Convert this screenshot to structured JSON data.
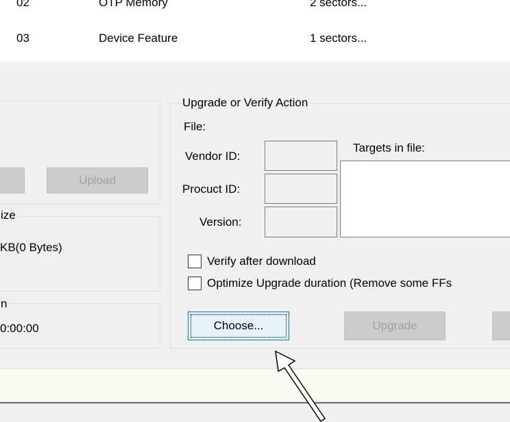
{
  "list": {
    "rows": [
      {
        "index": "02",
        "name": "OTP Memory",
        "size": "2 sectors..."
      },
      {
        "index": "03",
        "name": "Device Feature",
        "size": "1 sectors..."
      }
    ]
  },
  "left": {
    "upload_label": "Upload",
    "size_group_label": "ize",
    "size_value": "KB(0 Bytes)",
    "duration_group_label": "n",
    "duration_value": "0:00:00"
  },
  "upgrade": {
    "group_label": "Upgrade or Verify Action",
    "file_label": "File:",
    "vendor_label": "Vendor ID:",
    "product_label": "Procuct ID:",
    "version_label": "Version:",
    "targets_label": "Targets in file:",
    "verify_label": "Verify after download",
    "optimize_label": "Optimize Upgrade duration (Remove some FFs",
    "choose_label": "Choose...",
    "upgrade_label": "Upgrade"
  }
}
